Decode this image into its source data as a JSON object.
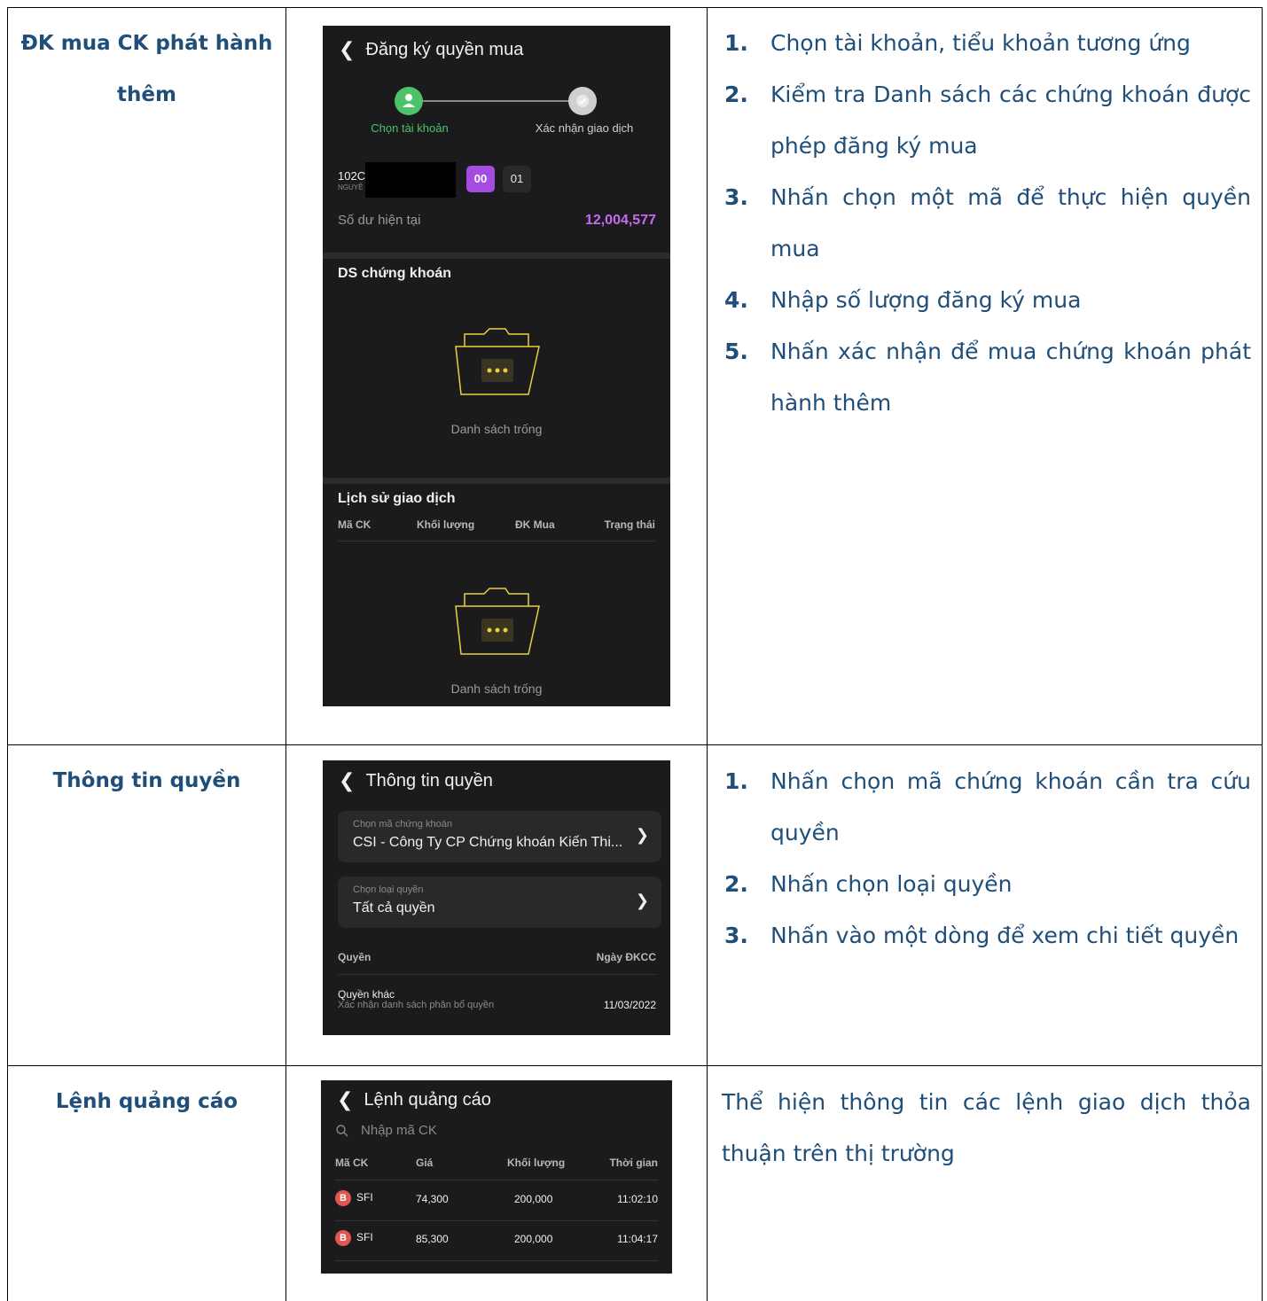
{
  "rows": [
    {
      "title": "ĐK mua CK phát hành thêm",
      "title_line1": "ĐK mua CK phát hành",
      "title_line2": "thêm",
      "phone": {
        "header": "Đăng ký quyền mua",
        "step1_label": "Chọn tài khoản",
        "step2_label": "Xác nhận giao dịch",
        "account_code": "102C",
        "account_name": "NGUYỄ",
        "sub_account_selected": "00",
        "sub_account_other": "01",
        "balance_label": "Số dư hiện tại",
        "balance_value": "12,004,577",
        "section1_title": "DS chứng khoán",
        "empty_text_1": "Danh sách trống",
        "section2_title": "Lịch sử giao dịch",
        "columns": [
          "Mã CK",
          "Khối lượng",
          "ĐK Mua",
          "Trạng thái"
        ],
        "empty_text_2": "Danh sách trống"
      },
      "steps": [
        {
          "num": "1.",
          "text": "Chọn tài khoản, tiểu khoản tương ứng"
        },
        {
          "num": "2.",
          "text": "Kiểm tra Danh sách các chứng khoán được phép đăng ký mua"
        },
        {
          "num": "3.",
          "text": "Nhấn chọn một mã để thực hiện quyền mua"
        },
        {
          "num": "4.",
          "text": "Nhập số lượng đăng ký mua"
        },
        {
          "num": "5.",
          "text": "Nhấn xác nhận để mua chứng khoán phát hành thêm"
        }
      ]
    },
    {
      "title": "Thông tin quyền",
      "phone": {
        "header": "Thông tin quyền",
        "select1_label": "Chọn mã chứng khoán",
        "select1_value": "CSI - Công Ty CP Chứng khoán Kiến Thi...",
        "select2_label": "Chọn loại quyền",
        "select2_value": "Tất cả quyền",
        "col_left": "Quyền",
        "col_right": "Ngày ĐKCC",
        "item_title": "Quyền khác",
        "item_sub": "Xác nhận danh sách phân bổ quyền",
        "item_date": "11/03/2022"
      },
      "steps": [
        {
          "num": "1.",
          "text": "Nhấn chọn mã chứng khoán cần tra cứu quyền"
        },
        {
          "num": "2.",
          "text": "Nhấn chọn loại quyền"
        },
        {
          "num": "3.",
          "text": "Nhấn vào một dòng để xem chi tiết quyền"
        }
      ]
    },
    {
      "title": "Lệnh quảng cáo",
      "phone": {
        "header": "Lệnh quảng cáo",
        "search_placeholder": "Nhập mã CK",
        "columns": [
          "Mã CK",
          "Giá",
          "Khối lượng",
          "Thời gian"
        ],
        "rows": [
          {
            "badge": "B",
            "code": "SFI",
            "price": "74,300",
            "volume": "200,000",
            "time": "11:02:10"
          },
          {
            "badge": "B",
            "code": "SFI",
            "price": "85,300",
            "volume": "200,000",
            "time": "11:04:17"
          }
        ]
      },
      "description": "Thể hiện thông tin các lệnh giao dịch thỏa thuận trên thị trường"
    }
  ],
  "colors": {
    "heading_text": "#1f4e79",
    "phone_bg": "#1b1b1d",
    "accent_green": "#4cc26a",
    "accent_purple": "#a44ce0",
    "balance_purple": "#c46cf0",
    "folder_yellow": "#e9cf3e",
    "badge_red": "#e0574f"
  }
}
